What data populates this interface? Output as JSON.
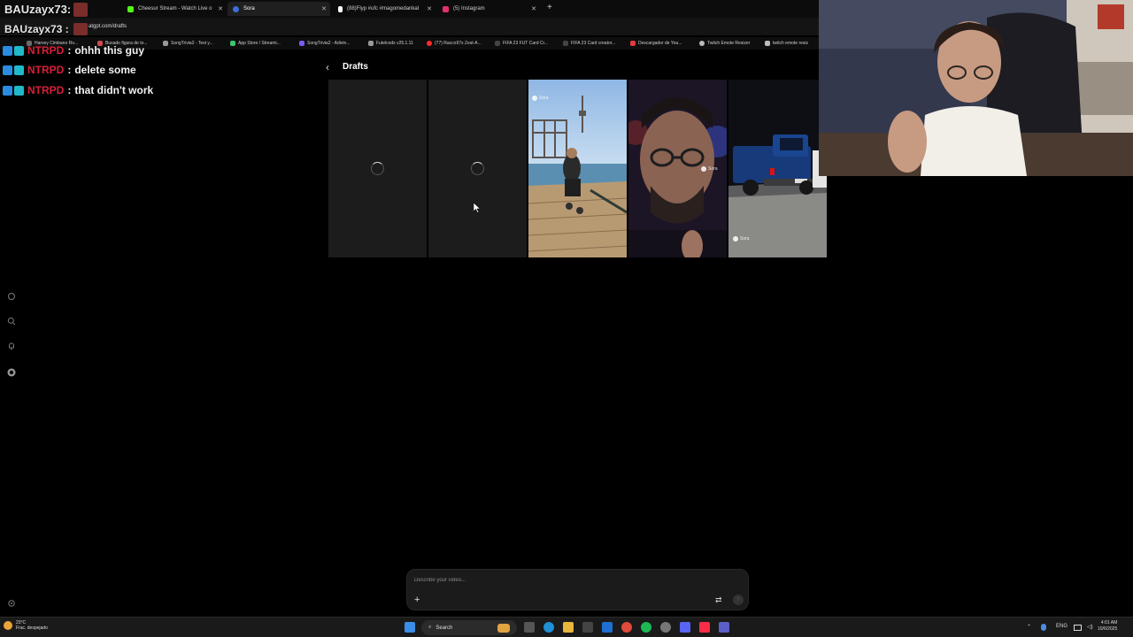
{
  "browser": {
    "tabs": [
      {
        "label": "Cheesur Stream - Watch Live o",
        "color": "#53fc18"
      },
      {
        "label": "Sora",
        "color": "#3b6fd8",
        "active": true
      },
      {
        "label": "(88)Flyp #ufc #magomedankal",
        "color": "#ffffff"
      },
      {
        "label": "(5) Instagram",
        "color": "#e1306c"
      }
    ],
    "new_tab": "+",
    "url": "atgpt.com/drafts",
    "bookmarks": [
      {
        "label": "Harvey Cimbano Ro...",
        "color": "#6b6b6b"
      },
      {
        "label": "Buxado figura de to...",
        "color": "#d04a4a"
      },
      {
        "label": "SongTrivia2 - Test y...",
        "color": "#999999"
      },
      {
        "label": "App Store / Streami...",
        "color": "#3ec46d"
      },
      {
        "label": "SongTrivia2 - Adivin...",
        "color": "#7a5cf0"
      },
      {
        "label": "Futelcods v25.1.11",
        "color": "#999999"
      },
      {
        "label": "(77) Racco97s Zest-A...",
        "color": "#ff2d2d"
      },
      {
        "label": "FIFA 23 FUT Card Cr...",
        "color": "#444444"
      },
      {
        "label": "FIFA 23 Card creator...",
        "color": "#444444"
      },
      {
        "label": "Descargador de You...",
        "color": "#e33b3b"
      },
      {
        "label": "Twitch Emote Resizer",
        "color": "#bbbbbb"
      },
      {
        "label": "twitch emote resiz",
        "color": "#bbbbbb"
      }
    ]
  },
  "chat": {
    "top_user": "BAUzayx73:",
    "second_user": "BAUzayx73 :",
    "messages": [
      {
        "user": "NTRPD",
        "sep": ":",
        "text": "ohhh this guy"
      },
      {
        "user": "NTRPD",
        "sep": ":",
        "text": "delete some"
      },
      {
        "user": "NTRPD",
        "sep": ":",
        "text": "that didn't work"
      }
    ]
  },
  "sora": {
    "sidebar_icons": [
      "home-icon",
      "search-icon",
      "notifications-icon",
      "profile-icon",
      "settings-icon"
    ],
    "page_title": "Drafts",
    "back_icon": "‹",
    "drafts": [
      {
        "state": "loading"
      },
      {
        "state": "loading"
      },
      {
        "state": "video",
        "scene": "pier",
        "watermark": "Sora"
      },
      {
        "state": "video",
        "scene": "selfie",
        "watermark": "Sora"
      },
      {
        "state": "video",
        "scene": "truck",
        "watermark": "Sora"
      }
    ],
    "prompt": {
      "placeholder": "Describe your video...",
      "plus_label": "+",
      "settings_icon": "⇄",
      "send_icon": "↑"
    }
  },
  "taskbar": {
    "weather_temp": "23°C",
    "weather_desc": "Frac. despejado",
    "search_label": "Search",
    "language": "ENG",
    "time": "4:01 AM",
    "date": "10/6/2025"
  }
}
